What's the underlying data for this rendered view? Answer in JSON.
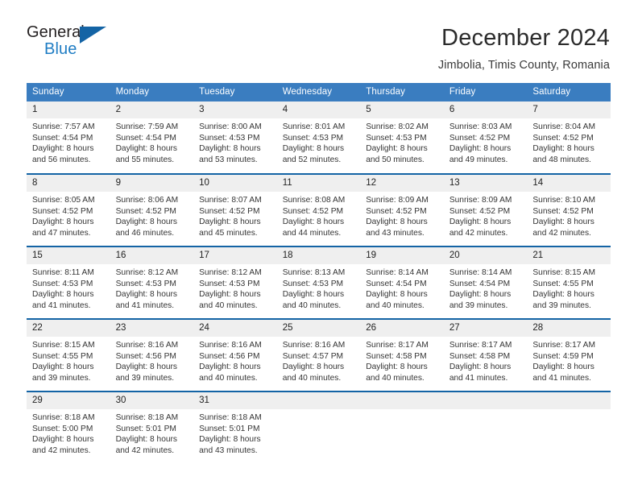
{
  "logo": {
    "word1": "General",
    "word2": "Blue",
    "triangle_color": "#1464a5",
    "blue_text_color": "#1f7dc4"
  },
  "header": {
    "title": "December 2024",
    "subtitle": "Jimbolia, Timis County, Romania"
  },
  "theme": {
    "header_bg": "#3a7dc0",
    "row_border": "#1464a5",
    "daynum_bg": "#efefef",
    "text": "#343434"
  },
  "weekdays": [
    "Sunday",
    "Monday",
    "Tuesday",
    "Wednesday",
    "Thursday",
    "Friday",
    "Saturday"
  ],
  "weeks": [
    [
      {
        "day": "1",
        "sunrise": "Sunrise: 7:57 AM",
        "sunset": "Sunset: 4:54 PM",
        "daylight1": "Daylight: 8 hours",
        "daylight2": "and 56 minutes."
      },
      {
        "day": "2",
        "sunrise": "Sunrise: 7:59 AM",
        "sunset": "Sunset: 4:54 PM",
        "daylight1": "Daylight: 8 hours",
        "daylight2": "and 55 minutes."
      },
      {
        "day": "3",
        "sunrise": "Sunrise: 8:00 AM",
        "sunset": "Sunset: 4:53 PM",
        "daylight1": "Daylight: 8 hours",
        "daylight2": "and 53 minutes."
      },
      {
        "day": "4",
        "sunrise": "Sunrise: 8:01 AM",
        "sunset": "Sunset: 4:53 PM",
        "daylight1": "Daylight: 8 hours",
        "daylight2": "and 52 minutes."
      },
      {
        "day": "5",
        "sunrise": "Sunrise: 8:02 AM",
        "sunset": "Sunset: 4:53 PM",
        "daylight1": "Daylight: 8 hours",
        "daylight2": "and 50 minutes."
      },
      {
        "day": "6",
        "sunrise": "Sunrise: 8:03 AM",
        "sunset": "Sunset: 4:52 PM",
        "daylight1": "Daylight: 8 hours",
        "daylight2": "and 49 minutes."
      },
      {
        "day": "7",
        "sunrise": "Sunrise: 8:04 AM",
        "sunset": "Sunset: 4:52 PM",
        "daylight1": "Daylight: 8 hours",
        "daylight2": "and 48 minutes."
      }
    ],
    [
      {
        "day": "8",
        "sunrise": "Sunrise: 8:05 AM",
        "sunset": "Sunset: 4:52 PM",
        "daylight1": "Daylight: 8 hours",
        "daylight2": "and 47 minutes."
      },
      {
        "day": "9",
        "sunrise": "Sunrise: 8:06 AM",
        "sunset": "Sunset: 4:52 PM",
        "daylight1": "Daylight: 8 hours",
        "daylight2": "and 46 minutes."
      },
      {
        "day": "10",
        "sunrise": "Sunrise: 8:07 AM",
        "sunset": "Sunset: 4:52 PM",
        "daylight1": "Daylight: 8 hours",
        "daylight2": "and 45 minutes."
      },
      {
        "day": "11",
        "sunrise": "Sunrise: 8:08 AM",
        "sunset": "Sunset: 4:52 PM",
        "daylight1": "Daylight: 8 hours",
        "daylight2": "and 44 minutes."
      },
      {
        "day": "12",
        "sunrise": "Sunrise: 8:09 AM",
        "sunset": "Sunset: 4:52 PM",
        "daylight1": "Daylight: 8 hours",
        "daylight2": "and 43 minutes."
      },
      {
        "day": "13",
        "sunrise": "Sunrise: 8:09 AM",
        "sunset": "Sunset: 4:52 PM",
        "daylight1": "Daylight: 8 hours",
        "daylight2": "and 42 minutes."
      },
      {
        "day": "14",
        "sunrise": "Sunrise: 8:10 AM",
        "sunset": "Sunset: 4:52 PM",
        "daylight1": "Daylight: 8 hours",
        "daylight2": "and 42 minutes."
      }
    ],
    [
      {
        "day": "15",
        "sunrise": "Sunrise: 8:11 AM",
        "sunset": "Sunset: 4:53 PM",
        "daylight1": "Daylight: 8 hours",
        "daylight2": "and 41 minutes."
      },
      {
        "day": "16",
        "sunrise": "Sunrise: 8:12 AM",
        "sunset": "Sunset: 4:53 PM",
        "daylight1": "Daylight: 8 hours",
        "daylight2": "and 41 minutes."
      },
      {
        "day": "17",
        "sunrise": "Sunrise: 8:12 AM",
        "sunset": "Sunset: 4:53 PM",
        "daylight1": "Daylight: 8 hours",
        "daylight2": "and 40 minutes."
      },
      {
        "day": "18",
        "sunrise": "Sunrise: 8:13 AM",
        "sunset": "Sunset: 4:53 PM",
        "daylight1": "Daylight: 8 hours",
        "daylight2": "and 40 minutes."
      },
      {
        "day": "19",
        "sunrise": "Sunrise: 8:14 AM",
        "sunset": "Sunset: 4:54 PM",
        "daylight1": "Daylight: 8 hours",
        "daylight2": "and 40 minutes."
      },
      {
        "day": "20",
        "sunrise": "Sunrise: 8:14 AM",
        "sunset": "Sunset: 4:54 PM",
        "daylight1": "Daylight: 8 hours",
        "daylight2": "and 39 minutes."
      },
      {
        "day": "21",
        "sunrise": "Sunrise: 8:15 AM",
        "sunset": "Sunset: 4:55 PM",
        "daylight1": "Daylight: 8 hours",
        "daylight2": "and 39 minutes."
      }
    ],
    [
      {
        "day": "22",
        "sunrise": "Sunrise: 8:15 AM",
        "sunset": "Sunset: 4:55 PM",
        "daylight1": "Daylight: 8 hours",
        "daylight2": "and 39 minutes."
      },
      {
        "day": "23",
        "sunrise": "Sunrise: 8:16 AM",
        "sunset": "Sunset: 4:56 PM",
        "daylight1": "Daylight: 8 hours",
        "daylight2": "and 39 minutes."
      },
      {
        "day": "24",
        "sunrise": "Sunrise: 8:16 AM",
        "sunset": "Sunset: 4:56 PM",
        "daylight1": "Daylight: 8 hours",
        "daylight2": "and 40 minutes."
      },
      {
        "day": "25",
        "sunrise": "Sunrise: 8:16 AM",
        "sunset": "Sunset: 4:57 PM",
        "daylight1": "Daylight: 8 hours",
        "daylight2": "and 40 minutes."
      },
      {
        "day": "26",
        "sunrise": "Sunrise: 8:17 AM",
        "sunset": "Sunset: 4:58 PM",
        "daylight1": "Daylight: 8 hours",
        "daylight2": "and 40 minutes."
      },
      {
        "day": "27",
        "sunrise": "Sunrise: 8:17 AM",
        "sunset": "Sunset: 4:58 PM",
        "daylight1": "Daylight: 8 hours",
        "daylight2": "and 41 minutes."
      },
      {
        "day": "28",
        "sunrise": "Sunrise: 8:17 AM",
        "sunset": "Sunset: 4:59 PM",
        "daylight1": "Daylight: 8 hours",
        "daylight2": "and 41 minutes."
      }
    ],
    [
      {
        "day": "29",
        "sunrise": "Sunrise: 8:18 AM",
        "sunset": "Sunset: 5:00 PM",
        "daylight1": "Daylight: 8 hours",
        "daylight2": "and 42 minutes."
      },
      {
        "day": "30",
        "sunrise": "Sunrise: 8:18 AM",
        "sunset": "Sunset: 5:01 PM",
        "daylight1": "Daylight: 8 hours",
        "daylight2": "and 42 minutes."
      },
      {
        "day": "31",
        "sunrise": "Sunrise: 8:18 AM",
        "sunset": "Sunset: 5:01 PM",
        "daylight1": "Daylight: 8 hours",
        "daylight2": "and 43 minutes."
      },
      {
        "day": "",
        "sunrise": "",
        "sunset": "",
        "daylight1": "",
        "daylight2": "",
        "empty": true
      },
      {
        "day": "",
        "sunrise": "",
        "sunset": "",
        "daylight1": "",
        "daylight2": "",
        "empty": true
      },
      {
        "day": "",
        "sunrise": "",
        "sunset": "",
        "daylight1": "",
        "daylight2": "",
        "empty": true
      },
      {
        "day": "",
        "sunrise": "",
        "sunset": "",
        "daylight1": "",
        "daylight2": "",
        "empty": true
      }
    ]
  ]
}
